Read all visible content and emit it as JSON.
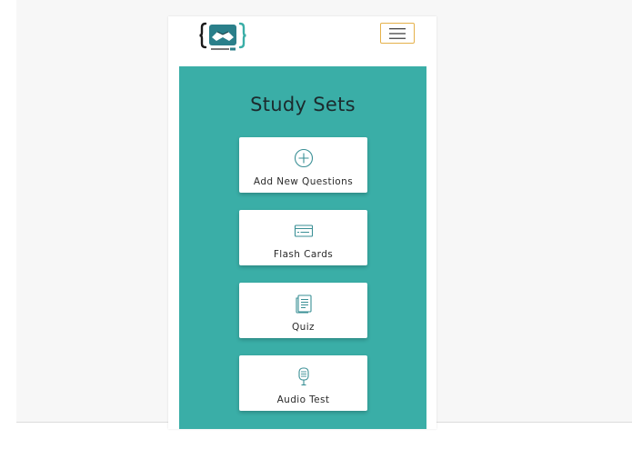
{
  "header": {
    "logo_icon": "handshake-brackets-logo",
    "menu_icon": "hamburger-icon",
    "accent_color": "#e5b14a"
  },
  "main": {
    "title": "Study Sets",
    "panel_color": "#3aaea7",
    "cards": [
      {
        "label": "Add New Questions",
        "icon": "plus-circle-icon"
      },
      {
        "label": "Flash Cards",
        "icon": "card-icon"
      },
      {
        "label": "Quiz",
        "icon": "document-icon"
      },
      {
        "label": "Audio Test",
        "icon": "microphone-icon"
      }
    ]
  }
}
